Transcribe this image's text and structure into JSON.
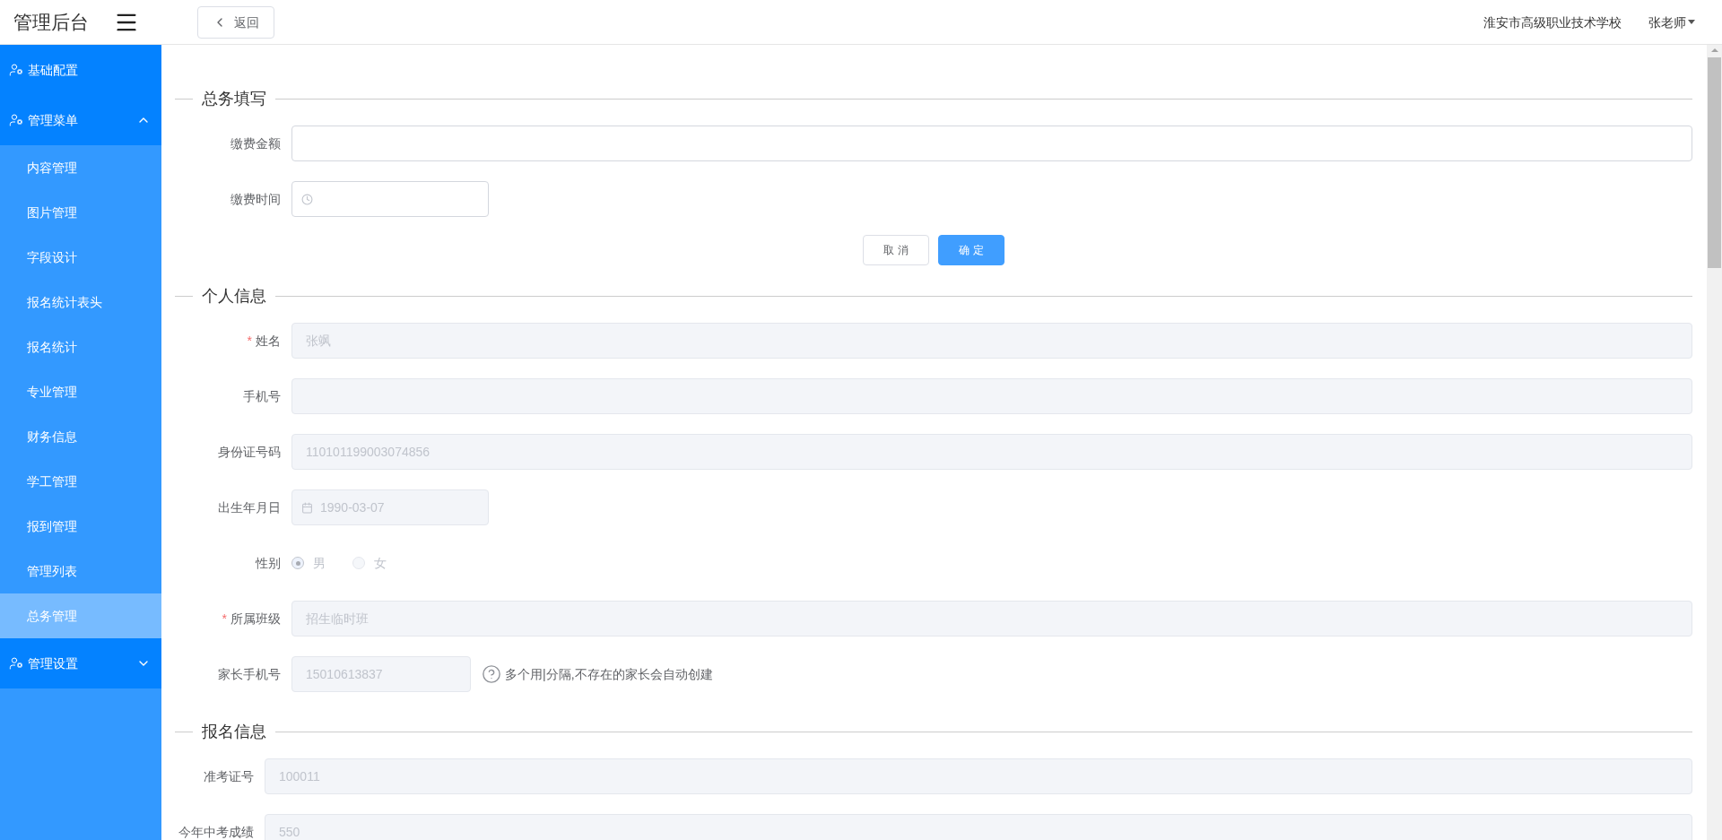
{
  "header": {
    "title": "管理后台",
    "back_button": "返回",
    "school": "淮安市高级职业技术学校",
    "user": "张老师"
  },
  "sidebar": {
    "items": [
      {
        "label": "基础配置"
      },
      {
        "label": "管理菜单",
        "expanded": true,
        "children": [
          {
            "label": "内容管理",
            "selected": false
          },
          {
            "label": "图片管理",
            "selected": false
          },
          {
            "label": "字段设计",
            "selected": false
          },
          {
            "label": "报名统计表头",
            "selected": false
          },
          {
            "label": "报名统计",
            "selected": false
          },
          {
            "label": "专业管理",
            "selected": false
          },
          {
            "label": "财务信息",
            "selected": false
          },
          {
            "label": "学工管理",
            "selected": false
          },
          {
            "label": "报到管理",
            "selected": false
          },
          {
            "label": "管理列表",
            "selected": false
          },
          {
            "label": "总务管理",
            "selected": true
          }
        ]
      },
      {
        "label": "管理设置",
        "expanded": false
      }
    ]
  },
  "sections": [
    {
      "legend": "总务填写",
      "fields": [
        {
          "kind": "text",
          "label": "缴费金额",
          "disabled": false
        },
        {
          "kind": "time",
          "label": "缴费时间",
          "disabled": false
        }
      ],
      "actions": [
        {
          "label": "取 消",
          "primary": false
        },
        {
          "label": "确 定",
          "primary": true
        }
      ]
    },
    {
      "legend": "个人信息",
      "fields": [
        {
          "kind": "text",
          "label": "姓名",
          "required_mark": "*",
          "disabled": true,
          "value": "张飒"
        },
        {
          "kind": "text",
          "label": "手机号",
          "disabled": true
        },
        {
          "kind": "text",
          "label": "身份证号码",
          "disabled": true,
          "value": "110101199003074856"
        },
        {
          "kind": "date",
          "label": "出生年月日",
          "disabled": true,
          "value": "1990-03-07"
        },
        {
          "kind": "radio",
          "label": "性别",
          "options": [
            {
              "label": "男",
              "selected": true
            },
            {
              "label": "女",
              "selected": false
            }
          ]
        },
        {
          "kind": "text",
          "label": "所属班级",
          "required_mark": "*",
          "disabled": true,
          "value": "招生临时班"
        },
        {
          "kind": "short",
          "label": "家长手机号",
          "disabled": true,
          "value": "15010613837",
          "hint": "多个用|分隔,不存在的家长会自动创建"
        }
      ]
    },
    {
      "legend": "报名信息",
      "fields": [
        {
          "kind": "text",
          "label": "准考证号",
          "disabled": true,
          "value": "100011"
        },
        {
          "kind": "text",
          "label": "今年中考成绩",
          "disabled": true,
          "value": "550"
        }
      ]
    }
  ]
}
